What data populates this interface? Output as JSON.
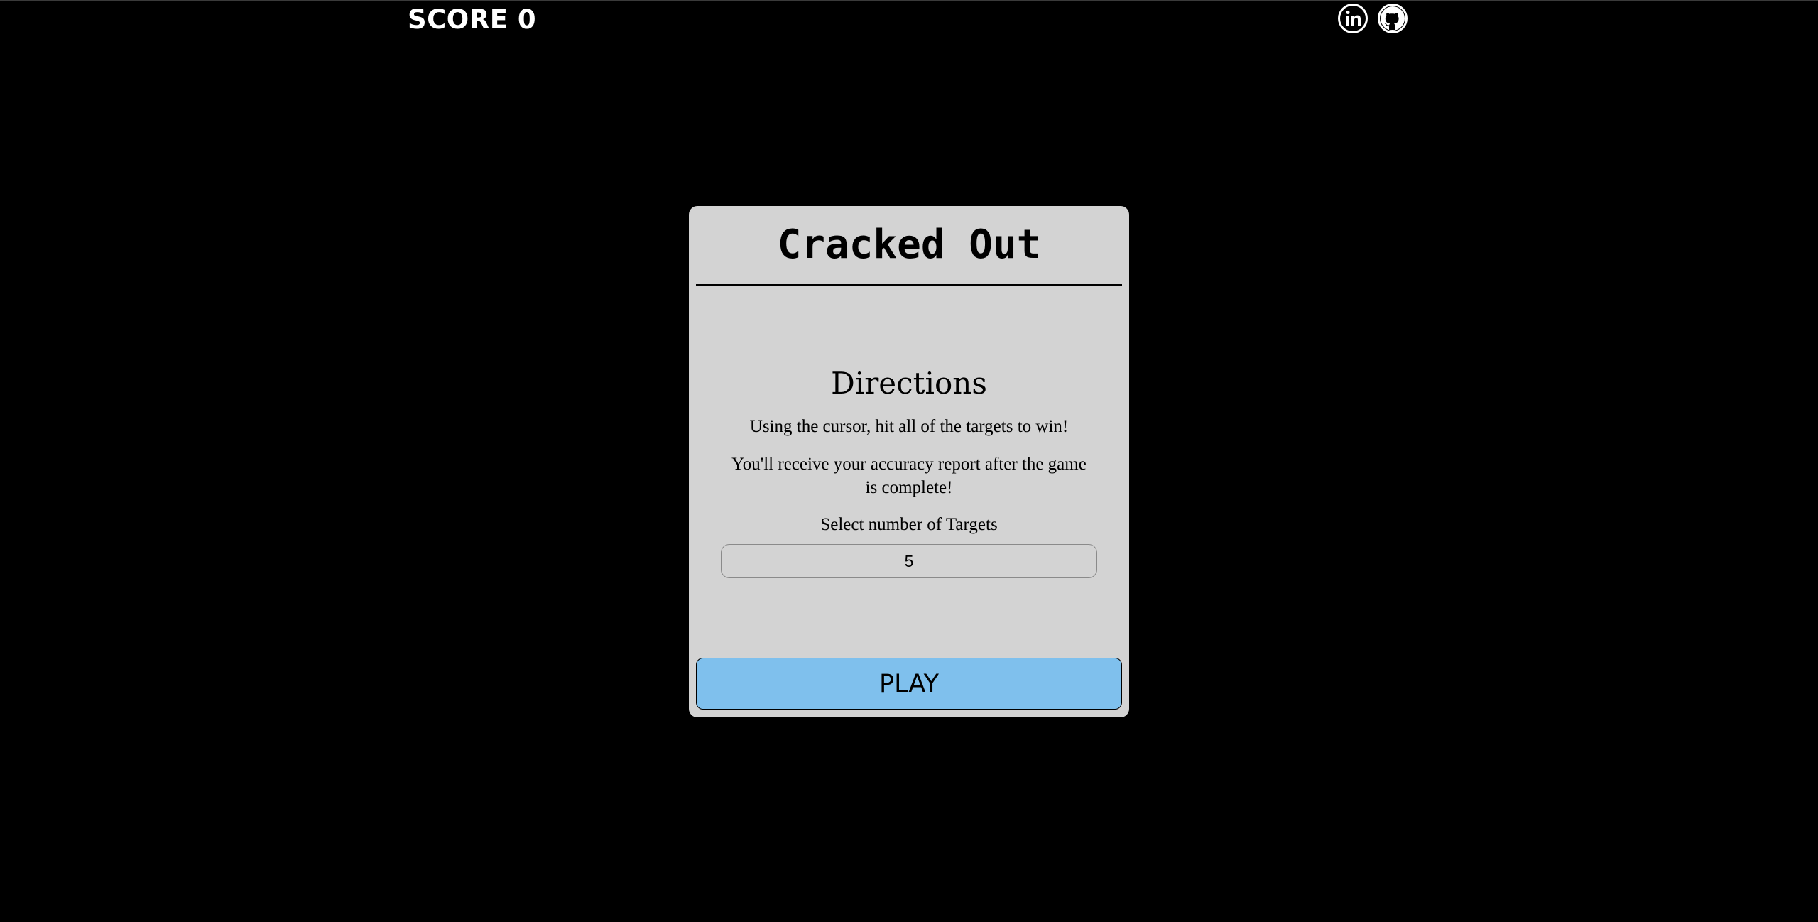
{
  "header": {
    "score_text": "SCORE 0",
    "social": [
      {
        "icon": "linkedin-icon"
      },
      {
        "icon": "github-icon"
      }
    ]
  },
  "modal": {
    "title": "Cracked Out",
    "directions_heading": "Directions",
    "directions_line_1": "Using the cursor, hit all of the targets to win!",
    "directions_line_2": "You'll receive your accuracy report after the game is complete!",
    "select_label": "Select number of Targets",
    "targets_value": "5",
    "play_label": "PLAY"
  },
  "colors": {
    "background": "#000000",
    "modal_background": "#d3d3d3",
    "play_button": "#7fc0ed",
    "text_light": "#ffffff"
  }
}
